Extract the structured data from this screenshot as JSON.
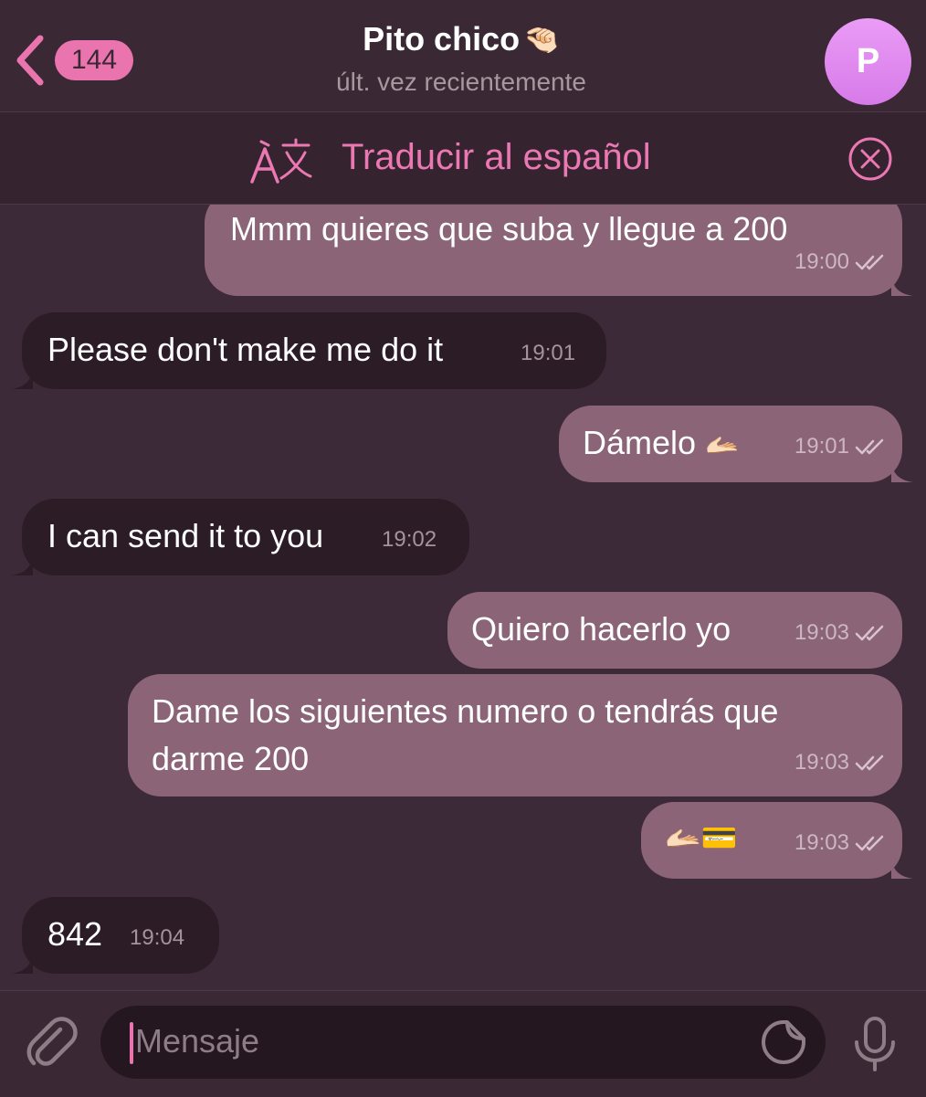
{
  "header": {
    "back_badge": "144",
    "title": "Pito chico",
    "title_emoji": "🤏🏻",
    "subtitle": "últ. vez recientemente",
    "avatar_letter": "P"
  },
  "translate_bar": {
    "label": "Traducir al español"
  },
  "messages": [
    {
      "side": "out",
      "text": "Mmm quieres que suba y llegue a 200",
      "time": "19:00",
      "read": true
    },
    {
      "side": "in",
      "text": "Please don't make me do it",
      "time": "19:01"
    },
    {
      "side": "out",
      "text": "Dámelo",
      "emoji": "🫴🏻",
      "time": "19:01",
      "read": true
    },
    {
      "side": "in",
      "text": "I can send it to you",
      "time": "19:02"
    },
    {
      "side": "out",
      "text": "Quiero hacerlo yo",
      "time": "19:03",
      "read": true
    },
    {
      "side": "out",
      "text_line1": "Dame los siguientes numero o tendrás que",
      "text_line2": "darme 200",
      "time": "19:03",
      "read": true
    },
    {
      "side": "out",
      "emoji": "🫴🏻💳",
      "time": "19:03",
      "read": true
    },
    {
      "side": "in",
      "text": "842",
      "time": "19:04"
    }
  ],
  "input": {
    "placeholder": "Mensaje"
  },
  "colors": {
    "accent": "#ea74ad",
    "outgoing_bubble": "#8b6577",
    "incoming_bubble": "#2b1c26",
    "background": "#3d2a38"
  }
}
